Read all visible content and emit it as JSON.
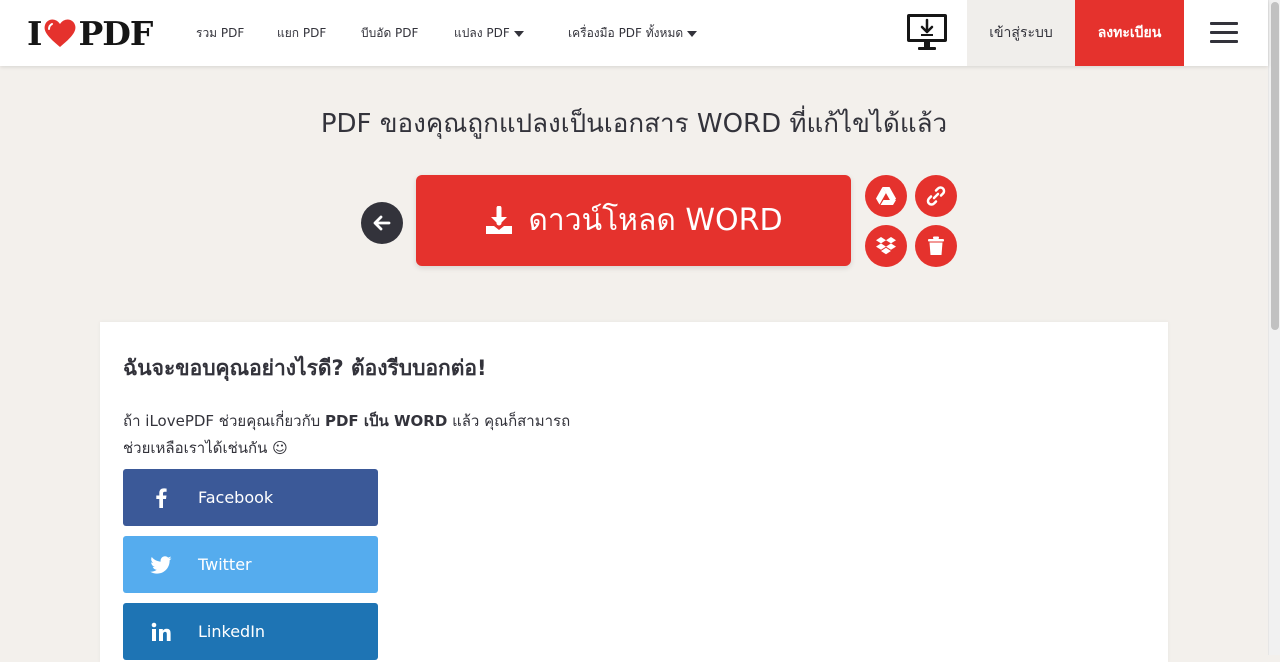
{
  "brand": {
    "logo_left": "I",
    "logo_right": "PDF",
    "accent": "#e5322d"
  },
  "nav": {
    "items": [
      {
        "label": "รวม PDF",
        "dropdown": false
      },
      {
        "label": "แยก PDF",
        "dropdown": false
      },
      {
        "label": "บีบอัด PDF",
        "dropdown": false
      },
      {
        "label": "แปลง PDF",
        "dropdown": true
      },
      {
        "label": "เครื่องมือ PDF ทั้งหมด",
        "dropdown": true
      }
    ],
    "login_label": "เข้าสู่ระบบ",
    "signup_label": "ลงทะเบียน"
  },
  "main": {
    "title": "PDF ของคุณถูกแปลงเป็นเอกสาร WORD ที่แก้ไขได้แล้ว",
    "download_label": "ดาวน์โหลด WORD"
  },
  "share": {
    "title": "ฉันจะขอบคุณอย่างไรดี? ต้องรีบบอกต่อ!",
    "text_prefix": "ถ้า iLovePDF ช่วยคุณเกี่ยวกับ ",
    "text_bold": "PDF เป็น WORD",
    "text_suffix": " แล้ว คุณก็สามารถ",
    "text_line2": "ช่วยเหลือเราได้เช่นกัน ☺",
    "buttons": [
      {
        "label": "Facebook",
        "icon": "facebook-icon",
        "color": "#3b5998"
      },
      {
        "label": "Twitter",
        "icon": "twitter-icon",
        "color": "#55acee"
      },
      {
        "label": "LinkedIn",
        "icon": "linkedin-icon",
        "color": "#1e74b4"
      }
    ]
  }
}
